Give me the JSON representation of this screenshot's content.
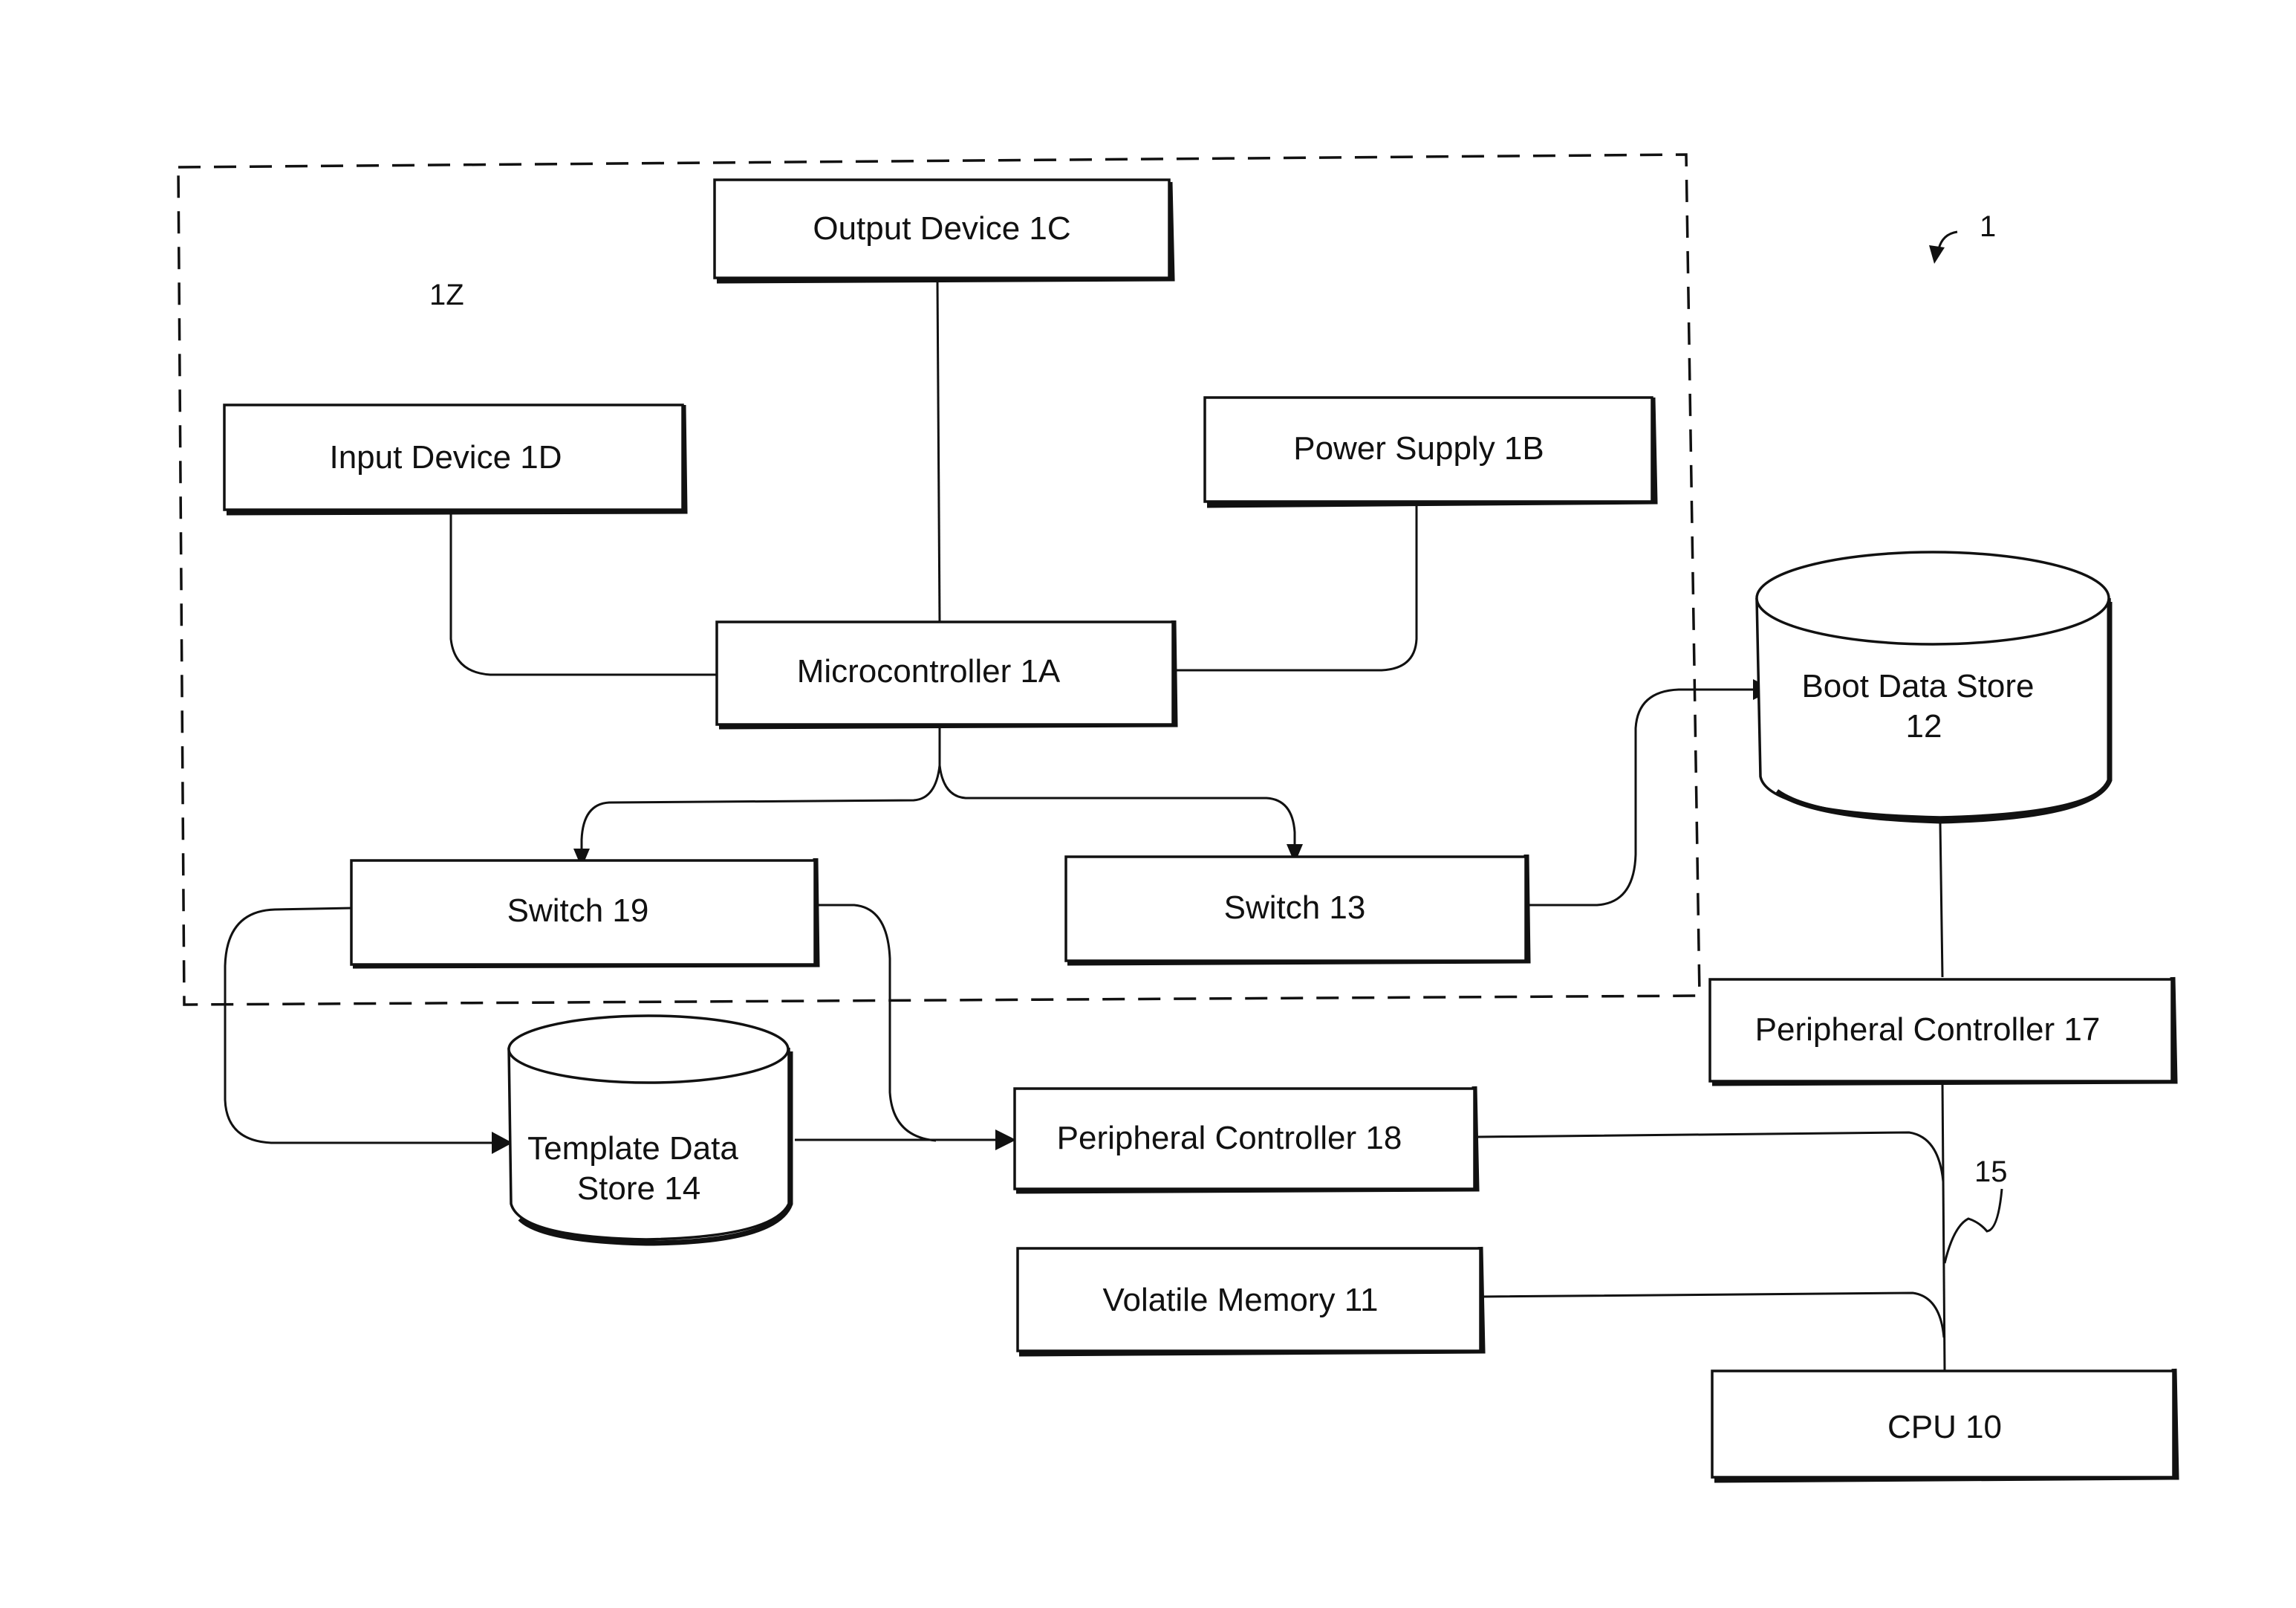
{
  "figure": {
    "reference_number": "1",
    "boundary_label": "1Z",
    "bus_label": "15"
  },
  "blocks": {
    "output_device": "Output Device 1C",
    "input_device": "Input Device 1D",
    "power_supply": "Power Supply 1B",
    "microcontroller": "Microcontroller 1A",
    "switch_19": "Switch 19",
    "switch_13": "Switch 13",
    "peripheral_controller_17": "Peripheral Controller 17",
    "peripheral_controller_18": "Peripheral Controller 18",
    "volatile_memory": "Volatile Memory 11",
    "cpu": "CPU 10"
  },
  "stores": {
    "boot_data_store": {
      "line1": "Boot Data Store",
      "line2": "12"
    },
    "template_data_store": {
      "line1": "Template Data",
      "line2": "Store 14"
    }
  },
  "connections": [
    {
      "from": "Output Device 1C",
      "to": "Microcontroller 1A",
      "arrow": false
    },
    {
      "from": "Input Device 1D",
      "to": "Microcontroller 1A",
      "arrow": false
    },
    {
      "from": "Power Supply 1B",
      "to": "Microcontroller 1A",
      "arrow": false
    },
    {
      "from": "Microcontroller 1A",
      "to": "Switch 19",
      "arrow": true
    },
    {
      "from": "Microcontroller 1A",
      "to": "Switch 13",
      "arrow": true
    },
    {
      "from": "Switch 13",
      "to": "Boot Data Store 12",
      "arrow": true
    },
    {
      "from": "Switch 19",
      "to": "Template Data Store 14",
      "arrow": true
    },
    {
      "from": "Switch 19",
      "to": "Peripheral Controller 18",
      "arrow": true
    },
    {
      "from": "Template Data Store 14",
      "to": "Peripheral Controller 18",
      "arrow": true
    },
    {
      "from": "Boot Data Store 12",
      "to": "Peripheral Controller 17",
      "arrow": false
    },
    {
      "from": "Peripheral Controller 17",
      "to": "CPU 10",
      "arrow": false,
      "via": "bus 15"
    },
    {
      "from": "Peripheral Controller 18",
      "to": "bus 15",
      "arrow": false
    },
    {
      "from": "Volatile Memory 11",
      "to": "bus 15",
      "arrow": false
    }
  ]
}
